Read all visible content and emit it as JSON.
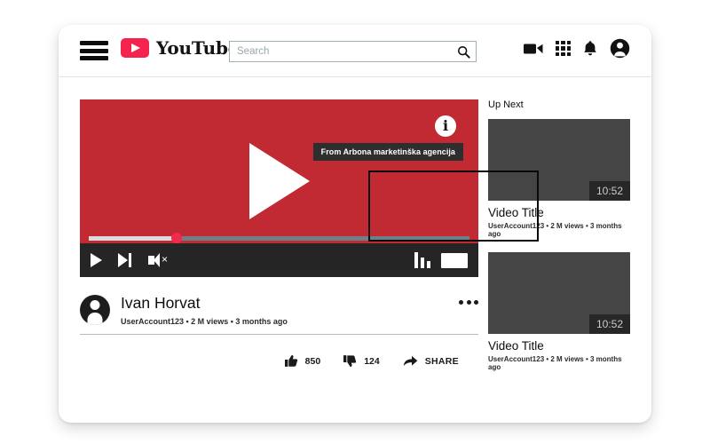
{
  "header": {
    "menu_icon": "hamburger-menu-icon",
    "logo_text": "YouTube",
    "logo_color": "#f4244f",
    "search": {
      "value": "",
      "placeholder": "Search",
      "button_icon": "search-icon"
    },
    "icons": [
      {
        "name": "video-camera-icon",
        "label": "Create"
      },
      {
        "name": "apps-grid-icon",
        "label": "Apps"
      },
      {
        "name": "bell-icon",
        "label": "Notifications"
      },
      {
        "name": "account-avatar-icon",
        "label": "Account"
      }
    ]
  },
  "player": {
    "background_color": "#c22a33",
    "play_icon": "play-triangle-icon",
    "info_badge_icon": "info-circle-icon",
    "info_badge_label": "i",
    "tooltip_text": "From Arbona marketinška agencija",
    "annotation_box": "highlight-rectangle",
    "progress_percent": 23,
    "controls": {
      "play": "play-icon",
      "next": "next-track-icon",
      "mute": "volume-muted-icon",
      "quality": "quality-bars-icon",
      "fullscreen": "fullscreen-icon"
    }
  },
  "video_info": {
    "title": "Ivan Horvat",
    "meta": "UserAccount123 • 2 M views • 3 months ago",
    "more_icon": "more-options-icon"
  },
  "actions": {
    "like": {
      "icon": "thumbs-up-icon",
      "count": "850"
    },
    "dislike": {
      "icon": "thumbs-down-icon",
      "count": "124"
    },
    "share": {
      "icon": "share-arrow-icon",
      "label": "SHARE"
    }
  },
  "up_next": {
    "heading": "Up Next",
    "items": [
      {
        "title": "Video Title",
        "meta": "UserAccount123 • 2 M views • 3 months ago",
        "duration": "10:52"
      },
      {
        "title": "Video Title",
        "meta": "UserAccount123 • 2 M views • 3 months ago",
        "duration": "10:52"
      }
    ]
  }
}
